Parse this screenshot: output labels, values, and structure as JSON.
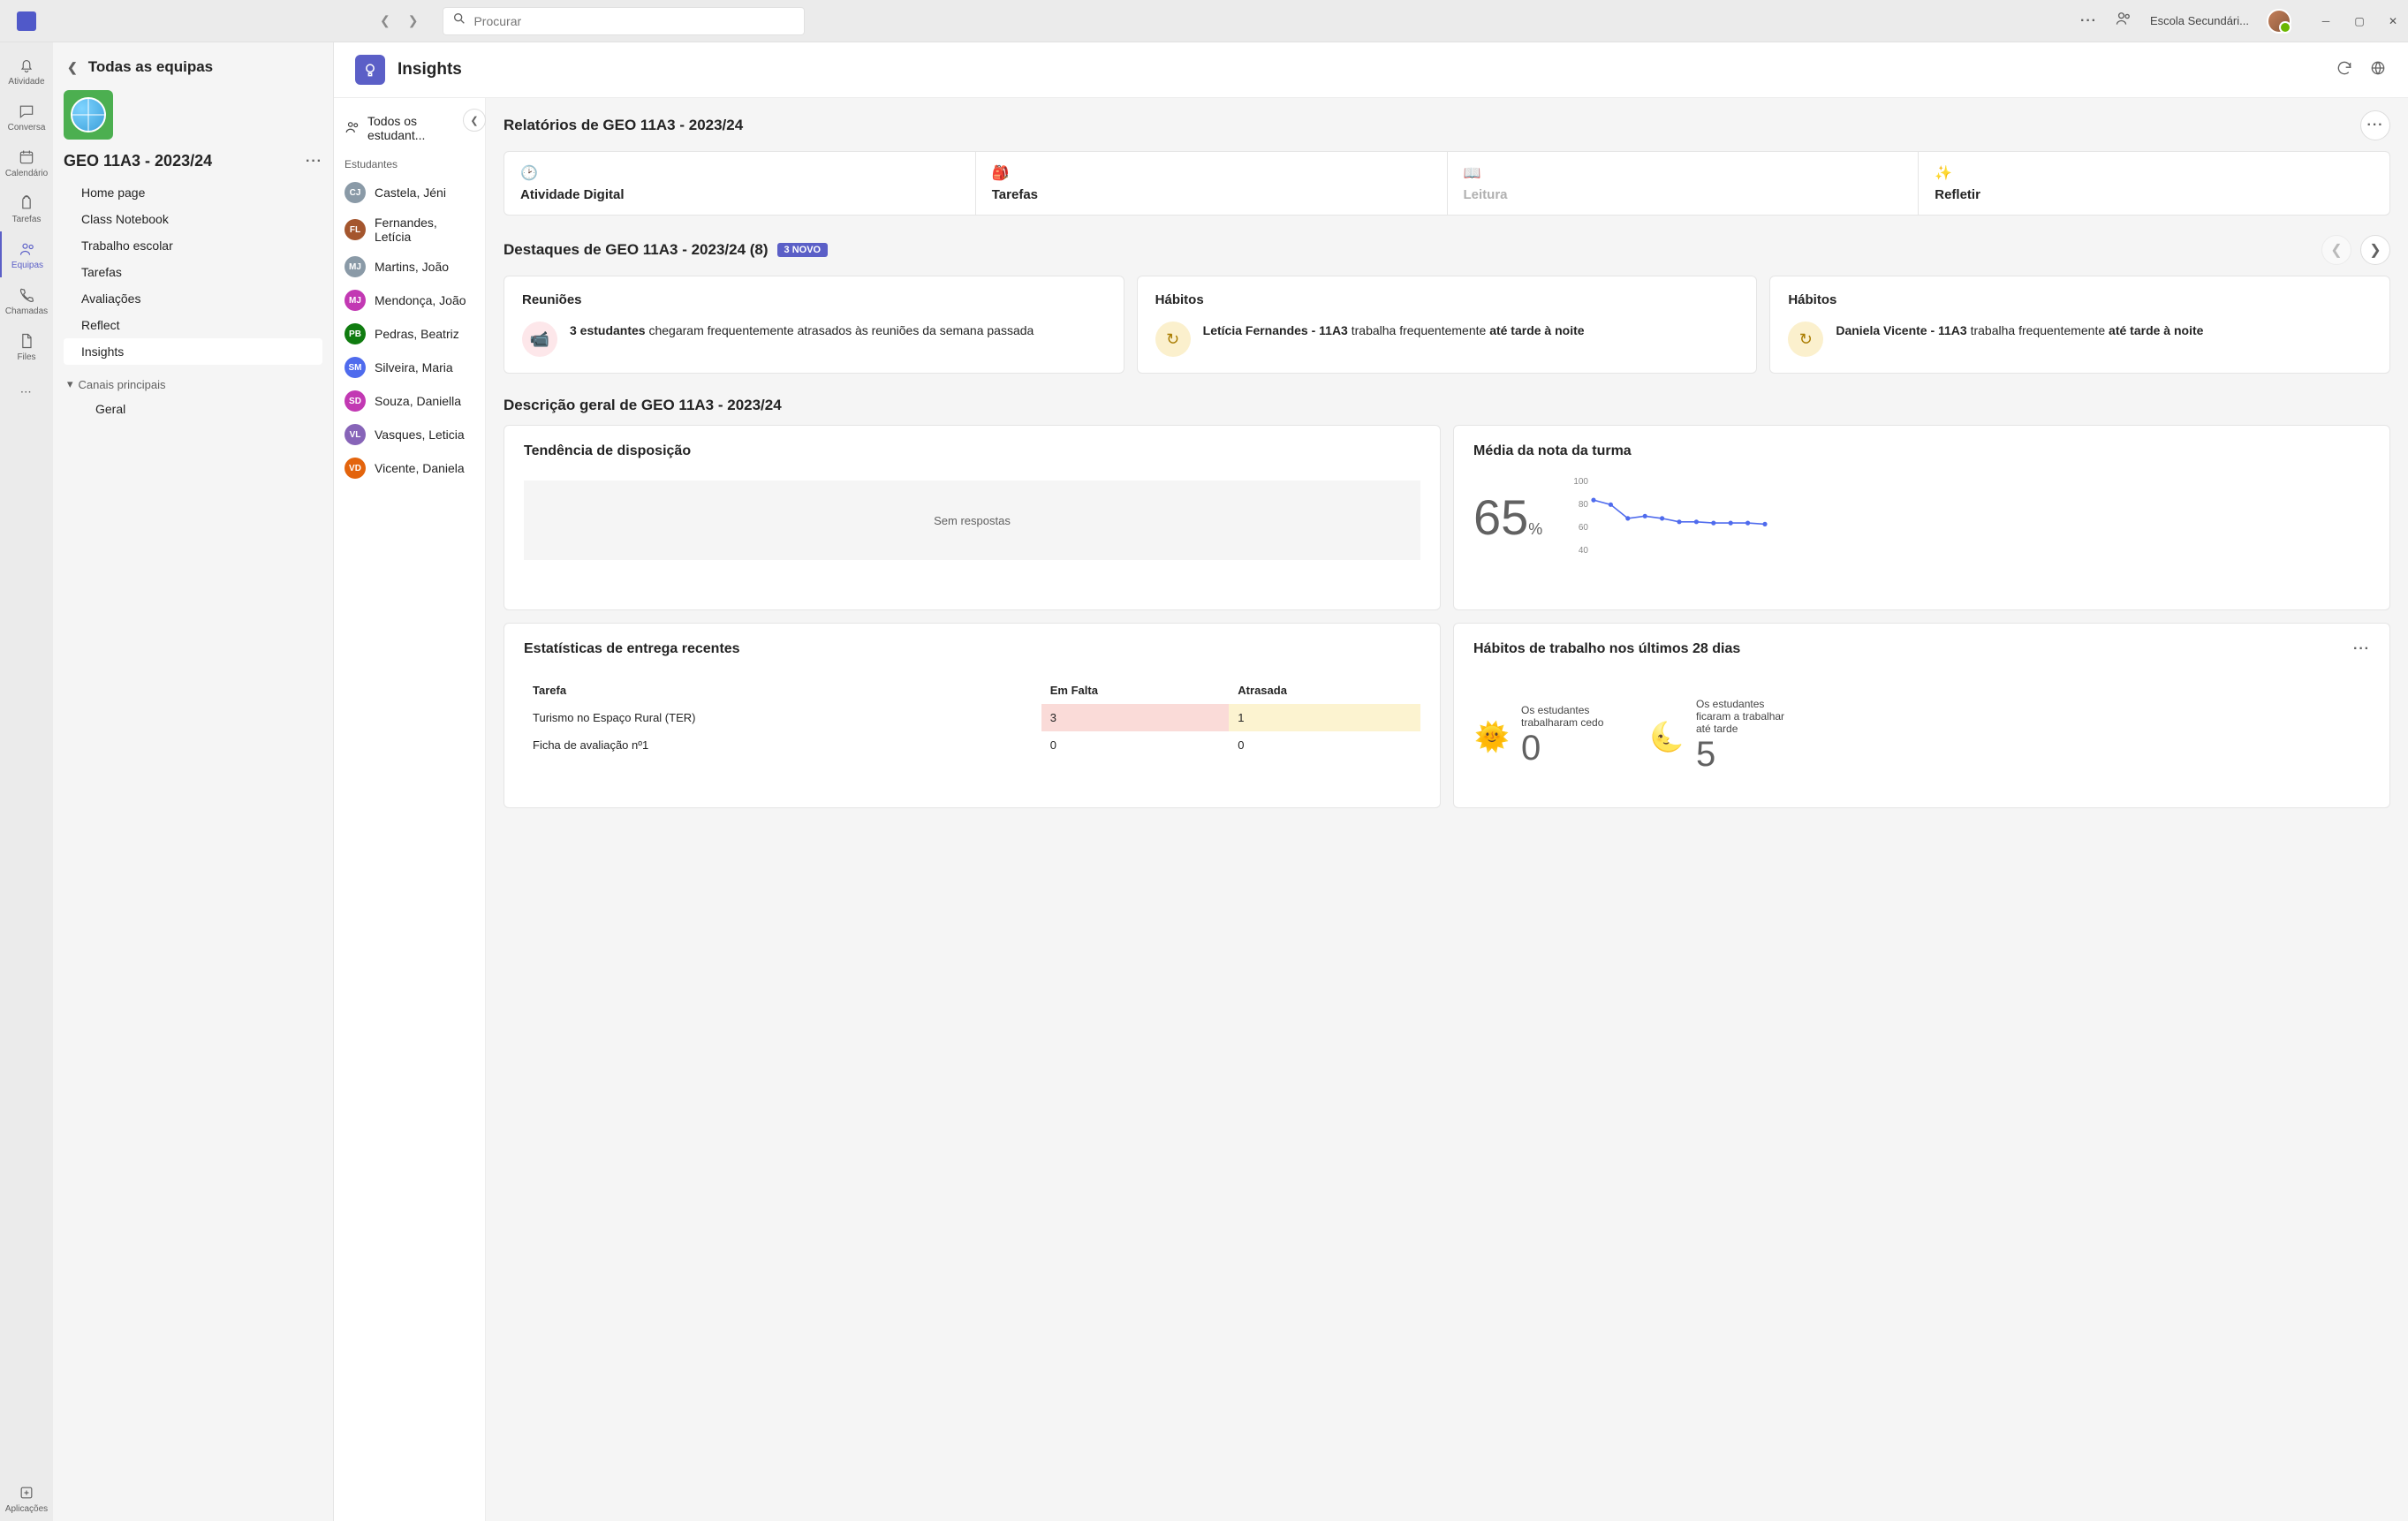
{
  "titlebar": {
    "search_placeholder": "Procurar",
    "org_label": "Escola Secundári..."
  },
  "rail": [
    {
      "id": "activity",
      "label": "Atividade"
    },
    {
      "id": "chat",
      "label": "Conversa"
    },
    {
      "id": "calendar",
      "label": "Calendário"
    },
    {
      "id": "assignments",
      "label": "Tarefas"
    },
    {
      "id": "teams",
      "label": "Equipas"
    },
    {
      "id": "calls",
      "label": "Chamadas"
    },
    {
      "id": "files",
      "label": "Files"
    }
  ],
  "apps_label": "Aplicações",
  "team_sidebar": {
    "back_label": "Todas as equipas",
    "team_name": "GEO 11A3 - 2023/24",
    "channels": [
      "Home page",
      "Class Notebook",
      "Trabalho escolar",
      "Tarefas",
      "Avaliações",
      "Reflect",
      "Insights"
    ],
    "channels_header": "Canais principais",
    "sub_channels": [
      "Geral"
    ]
  },
  "insights_header": {
    "title": "Insights"
  },
  "students": {
    "all_label": "Todos os estudant...",
    "section_label": "Estudantes",
    "list": [
      {
        "initials": "CJ",
        "name": "Castela, Jéni",
        "color": "#8a9aa7"
      },
      {
        "initials": "FL",
        "name": "Fernandes, Letícia",
        "color": "#a4562e"
      },
      {
        "initials": "MJ",
        "name": "Martins, João",
        "color": "#8a9aa7"
      },
      {
        "initials": "MJ",
        "name": "Mendonça, João",
        "color": "#c239b3"
      },
      {
        "initials": "PB",
        "name": "Pedras, Beatriz",
        "color": "#107c10"
      },
      {
        "initials": "SM",
        "name": "Silveira, Maria",
        "color": "#4f6bed"
      },
      {
        "initials": "SD",
        "name": "Souza, Daniella",
        "color": "#c239b3"
      },
      {
        "initials": "VL",
        "name": "Vasques, Leticia",
        "color": "#8764b8"
      },
      {
        "initials": "VD",
        "name": "Vicente, Daniela",
        "color": "#e3640d"
      }
    ]
  },
  "reports": {
    "title_prefix": "Relatórios de ",
    "class_name": "GEO 11A3 - 2023/24",
    "tabs": [
      {
        "id": "digital",
        "label": "Atividade Digital",
        "disabled": false
      },
      {
        "id": "assign",
        "label": "Tarefas",
        "disabled": false
      },
      {
        "id": "reading",
        "label": "Leitura",
        "disabled": true
      },
      {
        "id": "reflect",
        "label": "Refletir",
        "disabled": false
      }
    ],
    "spotlight": {
      "title_prefix": "Destaques de ",
      "count_suffix": " (8)",
      "badge": "3 NOVO",
      "cards": [
        {
          "heading": "Reuniões",
          "icon_class": "ci-pink",
          "bold": "3 estudantes",
          "rest": " chegaram frequentemente atrasados às reuniões da semana passada"
        },
        {
          "heading": "Hábitos",
          "icon_class": "ci-yellow",
          "bold": "Letícia Fernandes - 11A3",
          "mid": " trabalha frequentemente ",
          "bold2": "até tarde à noite"
        },
        {
          "heading": "Hábitos",
          "icon_class": "ci-yellow",
          "bold": "Daniela Vicente - 11A3",
          "mid": " trabalha frequentemente ",
          "bold2": "até tarde à noite"
        }
      ]
    },
    "overview_title_prefix": "Descrição geral de ",
    "trend": {
      "title": "Tendência de disposição",
      "empty": "Sem respostas"
    },
    "average": {
      "title": "Média da nota da turma",
      "value": "65",
      "unit": "%"
    },
    "recent": {
      "title": "Estatísticas de entrega recentes",
      "cols": [
        "Tarefa",
        "Em Falta",
        "Atrasada"
      ],
      "rows": [
        {
          "name": "Turismo no Espaço Rural (TER)",
          "miss": "3",
          "late": "1",
          "hl": true
        },
        {
          "name": "Ficha de avaliação nº1",
          "miss": "0",
          "late": "0",
          "hl": false
        }
      ]
    },
    "habits28": {
      "title": "Hábitos de trabalho nos últimos 28 dias",
      "early_label": "Os estudantes trabalharam cedo",
      "early_value": "0",
      "late_label": "Os estudantes ficaram a trabalhar até tarde",
      "late_value": "5"
    }
  },
  "chart_data": {
    "type": "line",
    "title": "Média da nota da turma",
    "ylabel": "",
    "ylim": [
      40,
      100
    ],
    "yticks": [
      40,
      60,
      80,
      100
    ],
    "x": [
      1,
      2,
      3,
      4,
      5,
      6,
      7,
      8,
      9,
      10,
      11
    ],
    "values": [
      83,
      79,
      67,
      69,
      67,
      64,
      64,
      63,
      63,
      63,
      62
    ]
  }
}
